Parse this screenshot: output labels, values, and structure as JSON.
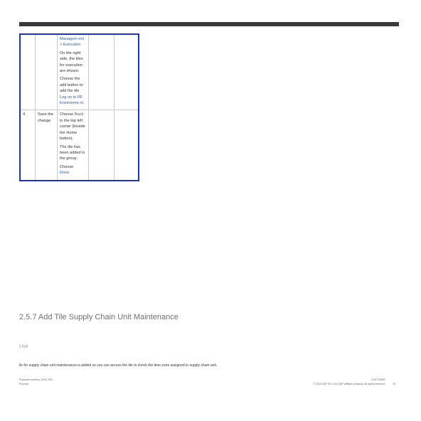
{
  "table": {
    "row_prev": {
      "instruction_link": "Managem ent > Execution",
      "para2": "On the right side, the tiles for execution are shown.",
      "para3_pre": "Choose the add button to add the tile ",
      "para3_link": "Log on to RF Environme nt",
      "para3_post": "."
    },
    "row4": {
      "num": "4.",
      "step": "Save the change",
      "para1_pre": "Choose ",
      "para1_link": "Back",
      "para1_post": " in the top left corner (beside the Home button).",
      "para2": "The tile has been added in the group.",
      "para3": "Choose",
      "para3_link": "Done."
    }
  },
  "section": {
    "title": "2.5.7 Add Tile Supply Chain Unit Maintenance",
    "subheading": "Use",
    "body": "ile for supply chain unit maintenance is added so you can access the tile to check the time zone assigned to supply chain unit."
  },
  "footer": {
    "left_line1": "Physical Inventory (1FW_DE)",
    "left_line2": "Purpose",
    "right_line1": "CUSTOMER",
    "right_line2": "© 2016 SAP SE or an SAP affiliate company. All rights reserved.",
    "page": "15"
  }
}
